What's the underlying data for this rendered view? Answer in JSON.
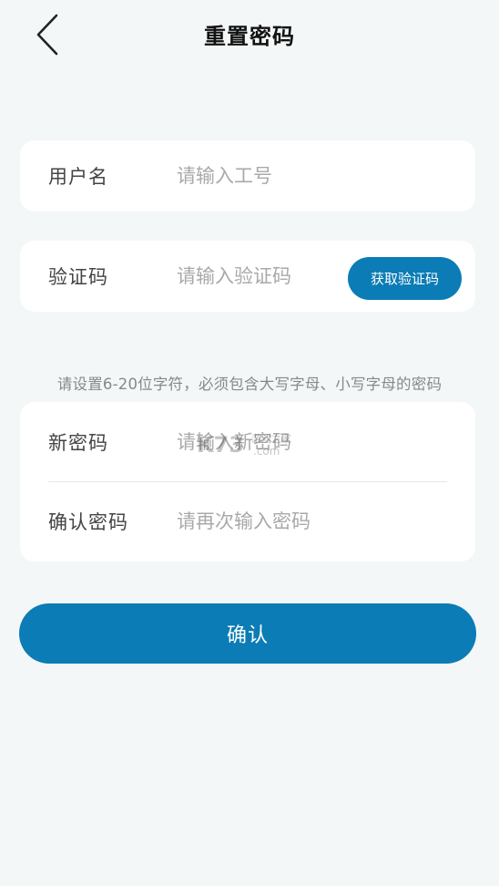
{
  "header": {
    "title": "重置密码",
    "back_icon": "chevron-left-icon"
  },
  "form": {
    "username": {
      "label": "用户名",
      "placeholder": "请输入工号"
    },
    "verification": {
      "label": "验证码",
      "placeholder": "请输入验证码",
      "get_code_label": "获取验证码"
    },
    "password_hint": "请设置6-20位字符，必须包含大写字母、小写字母的密码",
    "new_password": {
      "label": "新密码",
      "placeholder": "请输入新密码"
    },
    "confirm_password": {
      "label": "确认密码",
      "placeholder": "请再次输入密码"
    },
    "submit_label": "确认"
  },
  "watermark": {
    "text_brand": "K73",
    "text_cn": "游戏之家",
    "text_domain": ".com"
  },
  "colors": {
    "accent": "#0b7cb5",
    "background": "#f4f7f7",
    "card": "#ffffff"
  }
}
